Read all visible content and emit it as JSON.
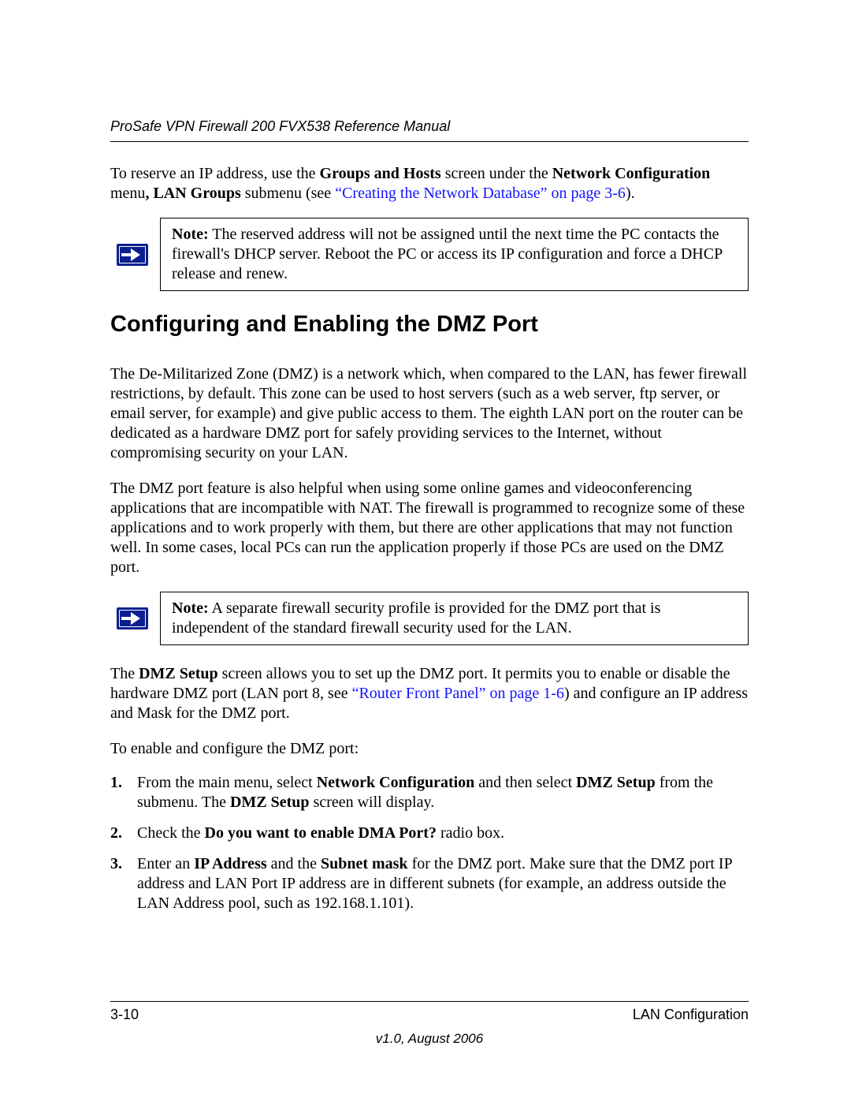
{
  "header": {
    "running_title": "ProSafe VPN Firewall 200 FVX538 Reference Manual"
  },
  "intro": {
    "p1_a": "To reserve an IP address, use the ",
    "p1_b": "Groups and Hosts",
    "p1_c": " screen under the ",
    "p1_d": "Network Configuration",
    "p1_e": " menu",
    "p1_f": ", LAN Groups",
    "p1_g": " submenu (see ",
    "p1_link": "“Creating the Network Database” on page 3-6",
    "p1_h": ")."
  },
  "note1": {
    "label": "Note:",
    "text": " The reserved address will not be assigned until the next time the PC contacts the firewall's DHCP server. Reboot the PC or access its IP configuration and force a DHCP release and renew."
  },
  "section_title": "Configuring and Enabling the DMZ Port",
  "body": {
    "p2": "The De-Militarized Zone (DMZ) is a network which, when compared to the LAN, has fewer firewall restrictions, by default. This zone can be used to host servers (such as a web server, ftp server, or email server, for example) and give public access to them. The eighth LAN port on the router can be dedicated as a hardware DMZ port for safely providing services to the Internet, without compromising security on your LAN.",
    "p3": "The DMZ port feature is also helpful when using some online games and videoconferencing applications that are incompatible with NAT. The firewall is programmed to recognize some of these applications and to work properly with them, but there are other applications that may not function well. In some cases, local PCs can run the application properly if those PCs are used on the DMZ port."
  },
  "note2": {
    "label": "Note:",
    "text": " A separate firewall security profile is provided for the DMZ port that is independent of the standard firewall security used for the LAN."
  },
  "para4": {
    "a": "The ",
    "b": "DMZ Setup",
    "c": " screen allows you to set up the DMZ port. It permits you to enable or disable the hardware DMZ port (LAN port 8, see ",
    "link": "“Router Front Panel” on page 1-6",
    "d": ") and configure an IP address and Mask for the DMZ port."
  },
  "p5": "To enable and configure the DMZ port:",
  "steps": {
    "s1_a": "From the main menu, select ",
    "s1_b": "Network Configuration",
    "s1_c": " and then select ",
    "s1_d": "DMZ Setup",
    "s1_e": " from the submenu. The ",
    "s1_f": "DMZ Setup",
    "s1_g": " screen will display.",
    "s2_a": "Check the ",
    "s2_b": "Do you want to enable DMA Port?",
    "s2_c": " radio box.",
    "s3_a": "Enter an ",
    "s3_b": "IP Address",
    "s3_c": " and the ",
    "s3_d": "Subnet mask",
    "s3_e": " for the DMZ port. Make sure that the DMZ port IP address and LAN Port IP address are in different subnets (for example, an address outside the LAN Address pool, such as 192.168.1.101)."
  },
  "footer": {
    "page_num": "3-10",
    "chapter": "LAN Configuration",
    "version": "v1.0, August 2006"
  }
}
